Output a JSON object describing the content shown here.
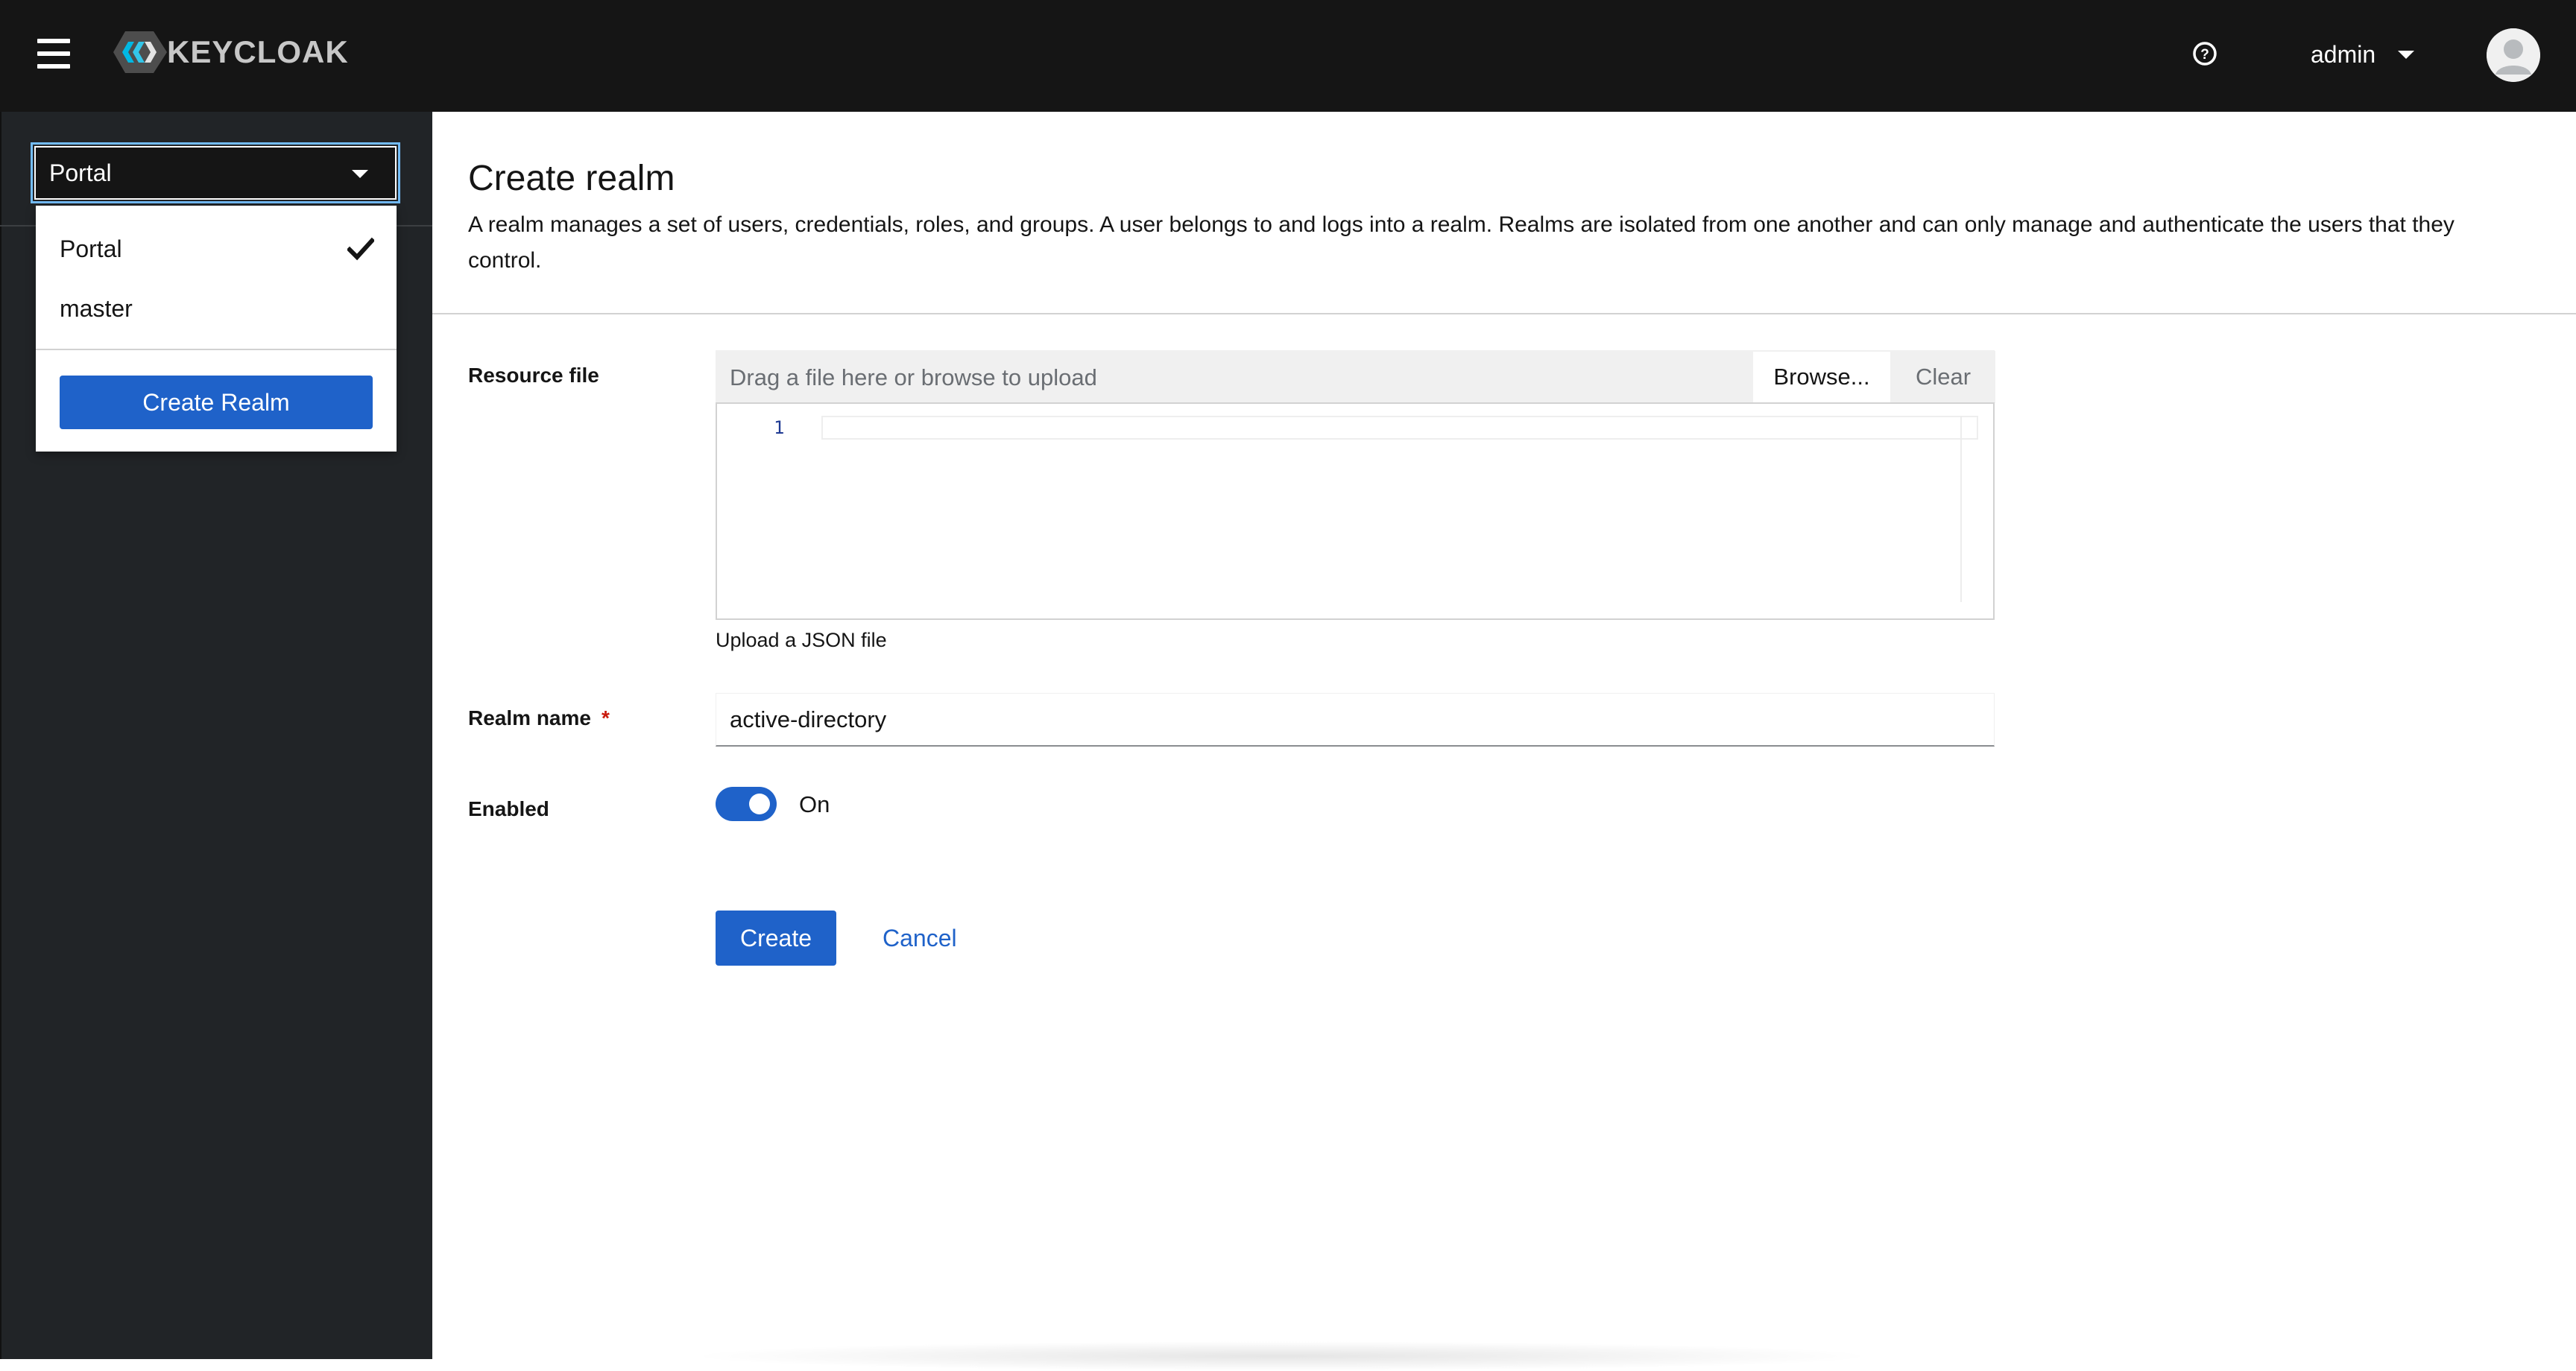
{
  "masthead": {
    "logo_text": "KEYCLOAK",
    "user_name": "admin",
    "icons": {
      "menu": "hamburger-menu-icon",
      "help": "help-circle-icon",
      "user_dropdown": "caret-down-icon",
      "avatar": "user-avatar-icon"
    }
  },
  "sidebar": {
    "realm_selector": {
      "selected": "Portal",
      "options": [
        {
          "label": "Portal",
          "checked": true
        },
        {
          "label": "master",
          "checked": false
        }
      ],
      "create_button": "Create Realm"
    }
  },
  "main": {
    "title": "Create realm",
    "description": "A realm manages a set of users, credentials, roles, and groups. A user belongs to and logs into a realm. Realms are isolated from one another and can only manage and authenticate the users that they control.",
    "resource_file": {
      "label": "Resource file",
      "placeholder": "Drag a file here or browse to upload",
      "browse_label": "Browse...",
      "clear_label": "Clear",
      "line_number": "1",
      "helper": "Upload a JSON file"
    },
    "realm_name": {
      "label": "Realm name",
      "required_mark": "*",
      "value": "active-directory"
    },
    "enabled": {
      "label": "Enabled",
      "state_label": "On",
      "on": true
    },
    "actions": {
      "create": "Create",
      "cancel": "Cancel"
    }
  },
  "colors": {
    "masthead_bg": "#151515",
    "sidebar_bg": "#212427",
    "primary": "#1f62c9",
    "required": "#c9190b"
  }
}
